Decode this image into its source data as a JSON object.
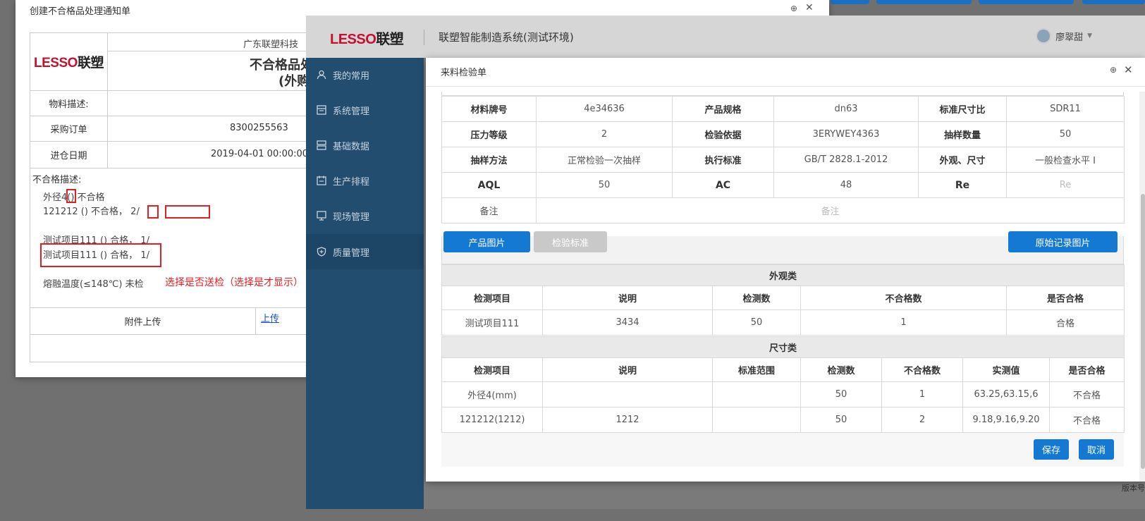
{
  "dialog1": {
    "title": "创建不合格品处理通知单",
    "company": "广东联塑科技",
    "logo_en": "LESSO",
    "logo_cn": "联塑",
    "doc_title": "不合格品处",
    "doc_subtitle": "(外购",
    "rows": [
      {
        "label": "物料描述:",
        "value": ""
      },
      {
        "label": "采购订单",
        "value": "8300255563"
      },
      {
        "label": "进仓日期",
        "value": "2019-04-01 00:00:00"
      }
    ],
    "defect_label": "不合格描述:",
    "defect_lines": [
      "外径4()  不合格",
      "121212  ()  不合格，  2/",
      "测试项目111  ()  合格，  1/",
      "测试项目111  ()  合格，  1/",
      "熔融温度(≤148℃) 未检"
    ],
    "annotation": "选择是否送检（选择是才显示）",
    "attachment_label": "附件上传",
    "upload_link": "上传"
  },
  "system": {
    "logo_en": "LESSO",
    "logo_cn": "联塑",
    "name": "联塑智能制造系统(测试环境)",
    "user": "廖翠甜",
    "footer": "版本号",
    "nav": [
      {
        "label": "我的常用",
        "icon": "user-icon"
      },
      {
        "label": "系统管理",
        "icon": "system-icon"
      },
      {
        "label": "基础数据",
        "icon": "database-icon"
      },
      {
        "label": "生产排程",
        "icon": "schedule-icon"
      },
      {
        "label": "现场管理",
        "icon": "monitor-icon"
      },
      {
        "label": "质量管理",
        "icon": "shield-icon"
      }
    ]
  },
  "dialog2": {
    "title": "来料检验单",
    "info_rows": [
      [
        "材料牌号",
        "4e34636",
        "产品规格",
        "dn63",
        "标准尺寸比",
        "SDR11"
      ],
      [
        "压力等级",
        "2",
        "检验依据",
        "3ERYWEY4363",
        "抽样数量",
        "50"
      ],
      [
        "抽样方法",
        "正常检验一次抽样",
        "执行标准",
        "GB/T 2828.1-2012",
        "外观、尺寸",
        "一般检查水平 I"
      ],
      [
        "AQL",
        "50",
        "AC",
        "48",
        "Re",
        ""
      ]
    ],
    "re_placeholder": "Re",
    "remark_label": "备注",
    "remark_placeholder": "备注",
    "buttons": {
      "product_images": "产品图片",
      "inspection_standard": "检验标准",
      "original_record_images": "原始记录图片",
      "save": "保存",
      "cancel": "取消"
    },
    "appearance": {
      "section": "外观类",
      "headers": [
        "检测项目",
        "说明",
        "检测数",
        "不合格数",
        "是否合格"
      ],
      "rows": [
        [
          "测试项目111",
          "3434",
          "50",
          "1",
          "合格"
        ]
      ]
    },
    "dimension": {
      "section": "尺寸类",
      "headers": [
        "检测项目",
        "说明",
        "标准范围",
        "检测数",
        "不合格数",
        "实测值",
        "是否合格"
      ],
      "rows": [
        [
          "外径4(mm)",
          "",
          "",
          "50",
          "1",
          "63.25,63.15,6",
          "不合格"
        ],
        [
          "121212(1212)",
          "1212",
          "",
          "50",
          "2",
          "9.18,9.16,9.20",
          "不合格"
        ]
      ]
    }
  }
}
